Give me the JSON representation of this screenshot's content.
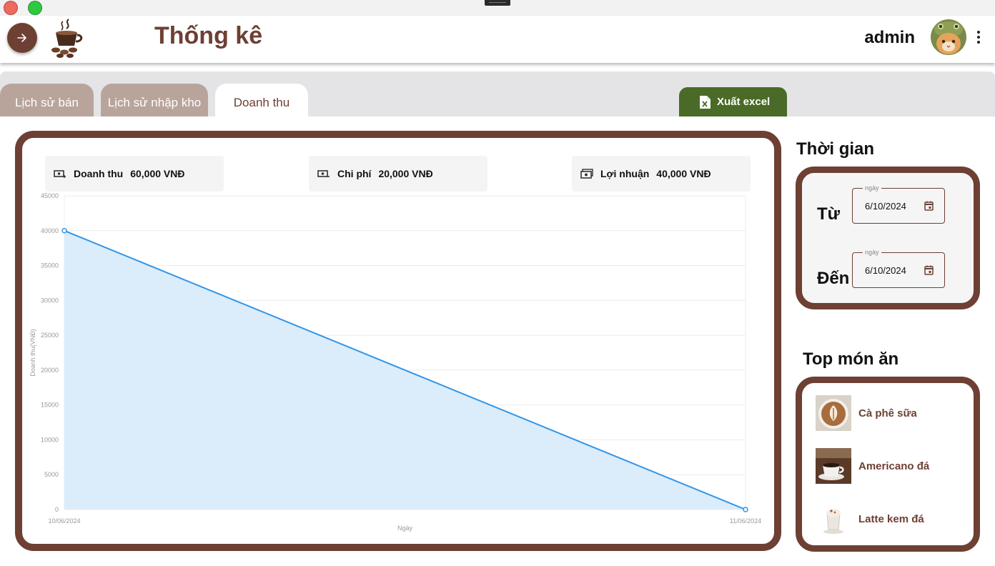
{
  "app": {
    "title": "Thống kê",
    "user": "admin"
  },
  "tabs": [
    {
      "label": "Lịch sử bán",
      "active": false
    },
    {
      "label": "Lịch sử nhập kho",
      "active": false
    },
    {
      "label": "Doanh thu",
      "active": true
    }
  ],
  "toolbar": {
    "export_label": "Xuất excel"
  },
  "summary": {
    "revenue": {
      "label": "Doanh thu",
      "value": "60,000 VNĐ"
    },
    "cost": {
      "label": "Chi phí",
      "value": "20,000 VNĐ"
    },
    "profit": {
      "label": "Lợi nhuận",
      "value": "40,000 VNĐ"
    }
  },
  "time_filter": {
    "title": "Thời gian",
    "from": {
      "label": "Từ",
      "field_label": "ngày",
      "value": "6/10/2024"
    },
    "to": {
      "label": "Đến",
      "field_label": "ngày",
      "value": "6/10/2024"
    }
  },
  "top_dishes": {
    "title": "Top món ăn",
    "items": [
      {
        "name": "Cà phê sữa"
      },
      {
        "name": "Americano đá"
      },
      {
        "name": "Latte kem đá"
      }
    ]
  },
  "colors": {
    "brand": "#6d4033",
    "excel": "#4a6b27",
    "line": "#2f95e8",
    "area": "#dbecfb"
  },
  "chart_data": {
    "type": "area",
    "x": [
      "10/06/2024",
      "11/06/2024"
    ],
    "series": [
      {
        "values": [
          40000,
          0
        ]
      }
    ],
    "xlabel": "Ngày",
    "ylabel": "Doanh thu(VNĐ)",
    "ylim": [
      0,
      45000
    ],
    "yticks": [
      0,
      5000,
      10000,
      15000,
      20000,
      25000,
      30000,
      35000,
      40000,
      45000
    ],
    "grid": true
  }
}
